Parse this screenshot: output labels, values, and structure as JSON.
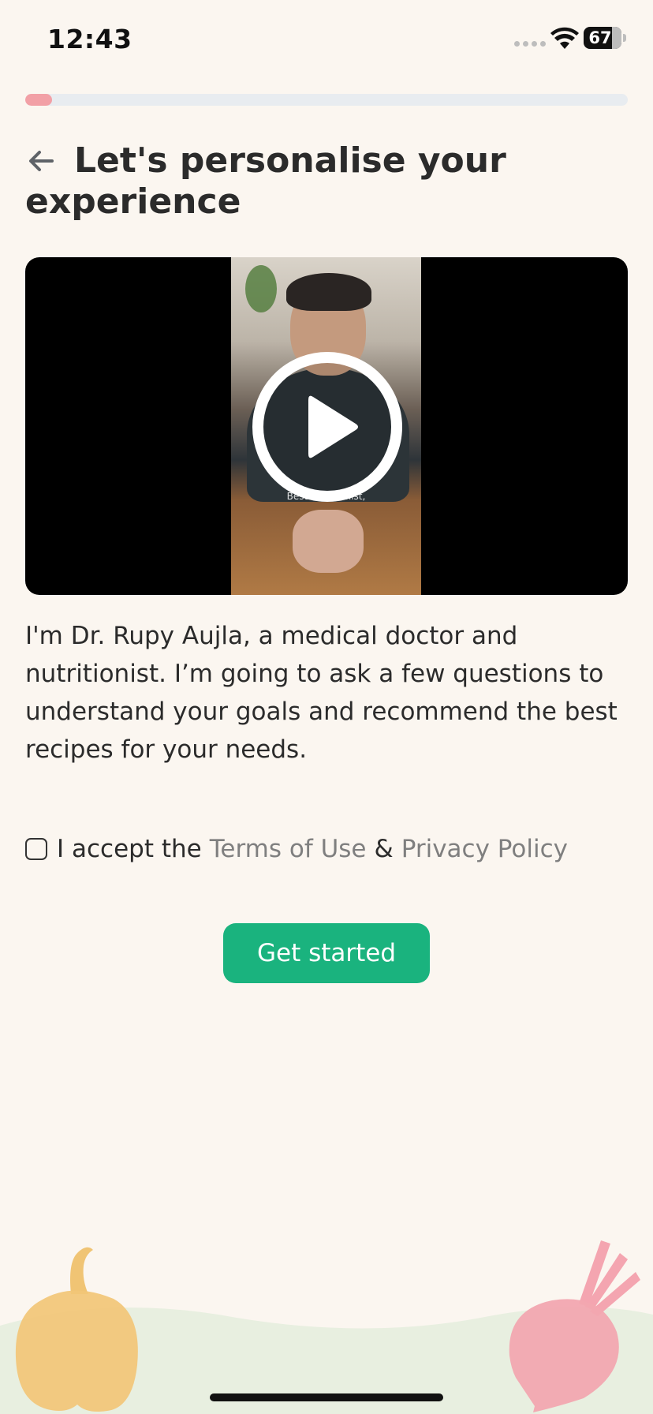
{
  "status_bar": {
    "time": "12:43",
    "battery": "67"
  },
  "progress": {
    "fraction": 0.045,
    "color": "#F2A0A6"
  },
  "header": {
    "title": "Let's personalise your experience"
  },
  "video": {
    "caption": "Best nutritionist,"
  },
  "intro_text": "I'm Dr. Rupy Aujla, a medical doctor and nutritionist. I’m going to ask a few questions to understand your goals and recommend the best recipes for your needs.",
  "terms": {
    "checked": false,
    "prefix": "I accept the",
    "terms_link": "Terms of Use",
    "separator": "&",
    "privacy_link": "Privacy Policy"
  },
  "cta": {
    "label": "Get started",
    "color": "#1AB37E"
  },
  "icons": {
    "back": "arrow-left-icon",
    "play": "play-icon",
    "wifi": "wifi-icon",
    "battery": "battery-icon"
  }
}
